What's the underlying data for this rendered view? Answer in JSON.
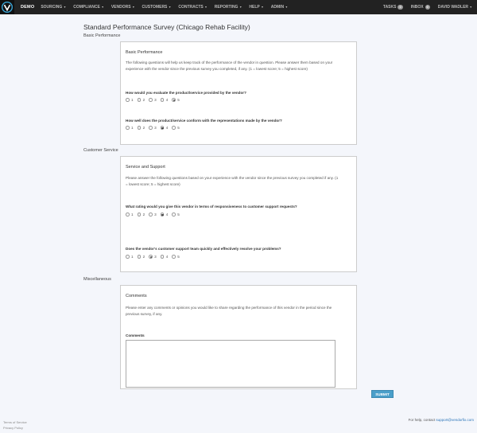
{
  "nav": {
    "brand": "DEMO",
    "menu": [
      "SOURCING",
      "COMPLIANCE",
      "VENDORS",
      "CUSTOMERS",
      "CONTRACTS",
      "REPORTING",
      "HELP",
      "ADMIN"
    ],
    "tasks_label": "TASKS",
    "tasks_count": "0",
    "inbox_label": "INBOX",
    "inbox_count": "0",
    "user": "DAVID WADLER"
  },
  "page": {
    "title": "Standard Performance Survey (Chicago Rehab Facility)"
  },
  "sections": {
    "basic": {
      "label": "Basic Performance",
      "panel_title": "Basic Performance",
      "desc": "The following questions will help us keep track of the performance of the vendor in question. Please answer them based on your experience with the vendor since the previous survey you completed, if any. (1 = lowest score; 5 = highest score)",
      "q1": "How would you evaluate the product/service provided by the vendor?",
      "q1_selected": 5,
      "q2": "How well does the product/service conform with the representations made by the vendor?",
      "q2_selected": 4
    },
    "support": {
      "label": "Customer Service",
      "panel_title": "Service and Support",
      "desc": "Please answer the following questions based on your experience with the vendor since the previous survey you completed if any. (1 = lowest score; 5 = highest score)",
      "q1": "What rating would you give this vendor in terms of responsiveness to customer support requests?",
      "q1_selected": 4,
      "q2": "Does the vendor's customer support team quickly and effectively resolve your problems?",
      "q2_selected": 3
    },
    "misc": {
      "label": "Miscellaneous",
      "panel_title": "Comments",
      "desc": "Please enter any comments or opinions you would like to share regarding the performance of this vendor in the period since the previous survey, if any.",
      "field_label": "Comments",
      "field_value": ""
    }
  },
  "options": [
    "1",
    "2",
    "3",
    "4",
    "5"
  ],
  "submit_label": "SUBMIT",
  "footer": {
    "terms": "Terms of Service",
    "privacy": "Privacy Policy",
    "help_prefix": "For help, contact",
    "help_email": "support@vendorfix.com"
  }
}
